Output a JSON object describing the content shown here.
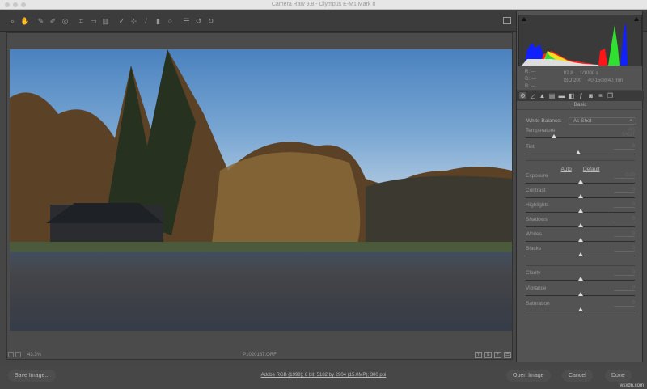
{
  "window": {
    "title": "Camera Raw 9.8  -  Olympus E-M1 Mark II"
  },
  "toolbar": {
    "tools": [
      {
        "name": "zoom-tool-icon",
        "glyph": "⌕"
      },
      {
        "name": "hand-tool-icon",
        "glyph": "✋"
      },
      {
        "name": "white-balance-tool-icon",
        "glyph": "✎"
      },
      {
        "name": "color-sampler-icon",
        "glyph": "✐"
      },
      {
        "name": "targeted-adjustment-icon",
        "glyph": "◎"
      },
      {
        "name": "crop-tool-icon",
        "glyph": "⌗"
      },
      {
        "name": "straighten-tool-icon",
        "glyph": "▭"
      },
      {
        "name": "transform-tool-icon",
        "glyph": "▥"
      },
      {
        "name": "spot-removal-icon",
        "glyph": "✓"
      },
      {
        "name": "red-eye-icon",
        "glyph": "⊹"
      },
      {
        "name": "adjustment-brush-icon",
        "glyph": "/"
      },
      {
        "name": "graduated-filter-icon",
        "glyph": "▮"
      },
      {
        "name": "radial-filter-icon",
        "glyph": "○"
      },
      {
        "name": "preferences-icon",
        "glyph": "☰"
      },
      {
        "name": "rotate-ccw-icon",
        "glyph": "↺"
      },
      {
        "name": "rotate-cw-icon",
        "glyph": "↻"
      }
    ]
  },
  "status": {
    "zoom": "43.3%",
    "filename": "P1020167.ORF"
  },
  "bottom": {
    "save": "Save Image...",
    "workflow": "Adobe RGB (1998); 8 bit; 5182 by 2904 (15.0MP); 300 ppi",
    "open": "Open Image",
    "cancel": "Cancel",
    "done": "Done",
    "watermark": "wsxdn.com"
  },
  "meta": {
    "r": "R:   ---",
    "g": "G:   ---",
    "b": "B:   ---",
    "aperture": "f/2.8",
    "shutter": "1/1000 s",
    "iso": "ISO 200",
    "lens": "40-150@40 mm"
  },
  "panel": {
    "section": "Basic",
    "wb_label": "White Balance:",
    "wb_value": "As Shot",
    "auto": "Auto",
    "default": "Default",
    "sliders": [
      {
        "label": "Temperature",
        "value": "AS SHOT",
        "pos": 0.26
      },
      {
        "label": "Tint",
        "value": "-9",
        "pos": 0.48
      },
      {
        "label": "Exposure",
        "value": "0.00",
        "pos": 0.5
      },
      {
        "label": "Contrast",
        "value": "0",
        "pos": 0.5
      },
      {
        "label": "Highlights",
        "value": "0",
        "pos": 0.5
      },
      {
        "label": "Shadows",
        "value": "0",
        "pos": 0.5
      },
      {
        "label": "Whites",
        "value": "0",
        "pos": 0.5
      },
      {
        "label": "Blacks",
        "value": "0",
        "pos": 0.5
      },
      {
        "label": "Clarity",
        "value": "0",
        "pos": 0.5
      },
      {
        "label": "Vibrance",
        "value": "0",
        "pos": 0.5
      },
      {
        "label": "Saturation",
        "value": "0",
        "pos": 0.5
      }
    ]
  }
}
